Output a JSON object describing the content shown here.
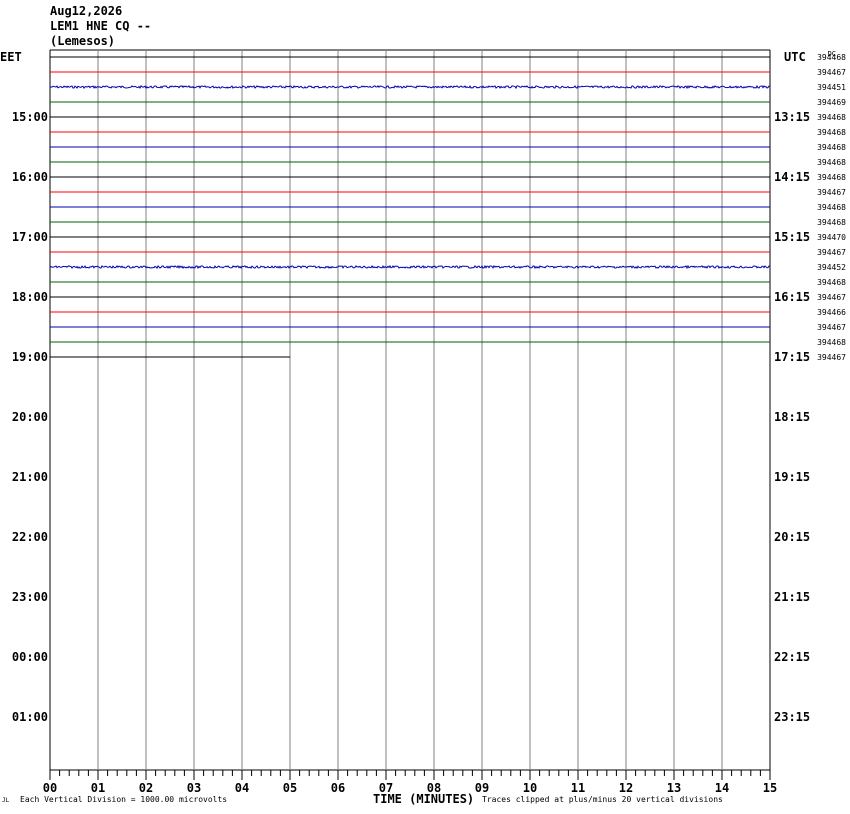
{
  "header": {
    "date": "Aug12,2026",
    "station": "LEM1 HNE CQ --",
    "location": "(Lemesos)"
  },
  "labels": {
    "left_tz": "EET",
    "right_tz": "UTC",
    "dc": "DC"
  },
  "footer": {
    "scale_note": "Each Vertical Division = 1000.00 microvolts",
    "xlabel": "TIME (MINUTES)",
    "clip_note": "Traces clipped at plus/minus 20 vertical divisions",
    "logo": "JL"
  },
  "colors": {
    "trace_cycle": [
      "#000000",
      "#ff0000",
      "#0000b0",
      "#006400"
    ],
    "grid": "#808080"
  },
  "chart_data": {
    "type": "line",
    "title": "Aug12,2026 LEM1 HNE CQ -- (Lemesos)",
    "xlabel": "TIME (MINUTES)",
    "xlim": [
      0,
      15
    ],
    "x_ticks": [
      "00",
      "01",
      "02",
      "03",
      "04",
      "05",
      "06",
      "07",
      "08",
      "09",
      "10",
      "11",
      "12",
      "13",
      "14",
      "15"
    ],
    "left_hour_labels": [
      "15:00",
      "16:00",
      "17:00",
      "18:00",
      "19:00",
      "20:00",
      "21:00",
      "22:00",
      "23:00",
      "00:00",
      "01:00"
    ],
    "right_hour_labels": [
      "13:15",
      "14:15",
      "15:15",
      "16:15",
      "17:15",
      "18:15",
      "19:15",
      "20:15",
      "21:15",
      "22:15",
      "23:15"
    ],
    "dc_offsets": [
      394468,
      394467,
      394451,
      394469,
      394468,
      394468,
      394468,
      394468,
      394468,
      394467,
      394468,
      394468,
      394470,
      394467,
      394452,
      394468,
      394467,
      394466,
      394467,
      394468,
      394467
    ],
    "noisy_traces": [
      2,
      14
    ],
    "last_trace_end_minute": 5
  }
}
